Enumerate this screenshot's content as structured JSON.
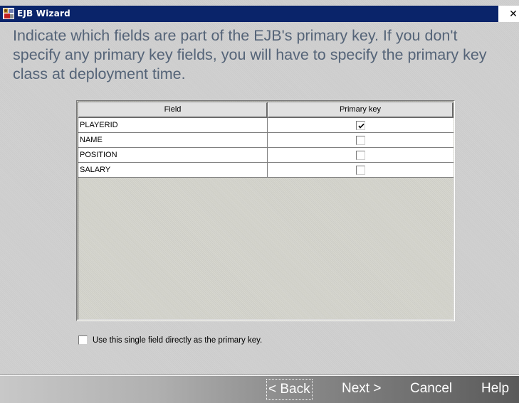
{
  "window": {
    "title": "EJB Wizard",
    "close_label": "x",
    "icon": "app-icon"
  },
  "instructions": {
    "line1": "Indicate which fields are part of the EJB's primary key.  If you don't",
    "line2": "specify any primary key fields, you will have to specify the primary key",
    "line3": "class at deployment time."
  },
  "table": {
    "columns": [
      "Field",
      "Primary key"
    ],
    "rows": [
      {
        "field": "PLAYERID",
        "primary_key": true
      },
      {
        "field": "NAME",
        "primary_key": false
      },
      {
        "field": "POSITION",
        "primary_key": false
      },
      {
        "field": "SALARY",
        "primary_key": false
      }
    ]
  },
  "single_field_option": {
    "label": "Use this single field directly as the primary key.",
    "checked": false
  },
  "buttons": {
    "back": "< Back",
    "next": "Next >",
    "cancel": "Cancel",
    "help": "Help"
  },
  "colors": {
    "title_bar": "#0a246a",
    "heading_text": "#556478",
    "button_text": "#ffffff"
  }
}
